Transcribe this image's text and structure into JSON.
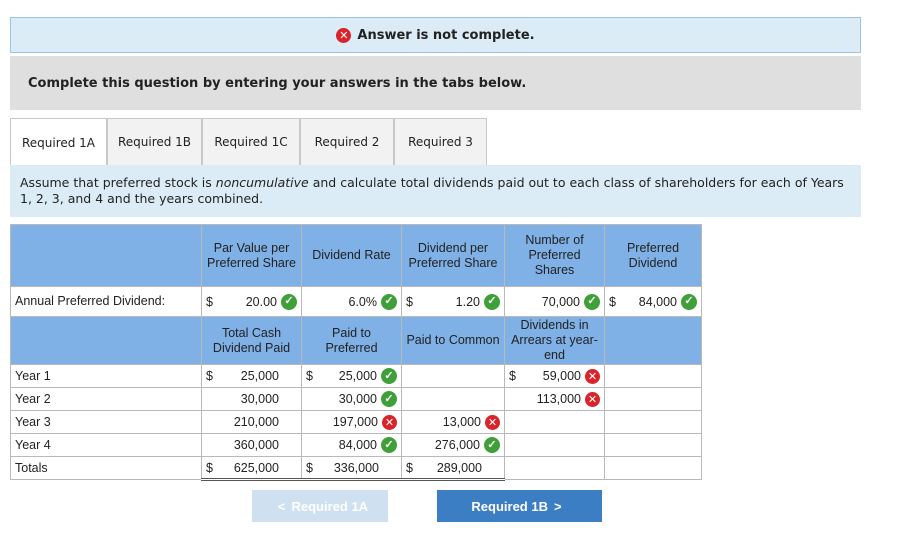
{
  "alert": {
    "text": "Answer is not complete."
  },
  "instruction": "Complete this question by entering your answers in the tabs below.",
  "tabs": [
    "Required 1A",
    "Required 1B",
    "Required 1C",
    "Required 2",
    "Required 3"
  ],
  "question": {
    "part1": "Assume that preferred stock is ",
    "emph": "noncumulative",
    "part2": " and calculate total dividends paid out to each class of shareholders for each of Years 1, 2, 3, and 4 and the years combined."
  },
  "table": {
    "header1": {
      "par_value": "Par Value per Preferred Share",
      "dividend_rate": "Dividend Rate",
      "dividend_per_share": "Dividend per Preferred Share",
      "num_shares": "Number of Preferred Shares",
      "preferred_dividend": "Preferred Dividend"
    },
    "annual": {
      "label": "Annual Preferred Dividend:",
      "par_value": "20.00",
      "dividend_rate": "6.0%",
      "dividend_per_share": "1.20",
      "num_shares": "70,000",
      "preferred_dividend": "84,000"
    },
    "header2": {
      "total_cash": "Total Cash Dividend Paid",
      "paid_pref": "Paid to Preferred",
      "paid_common": "Paid to Common",
      "arrears": "Dividends in Arrears at year-end"
    },
    "rows": [
      {
        "label": "Year 1",
        "total": "25,000",
        "pref": "25,000",
        "pref_status": "ok",
        "common": "",
        "common_status": "",
        "arrears": "59,000",
        "arrears_status": "x"
      },
      {
        "label": "Year 2",
        "total": "30,000",
        "pref": "30,000",
        "pref_status": "ok",
        "common": "",
        "common_status": "",
        "arrears": "113,000",
        "arrears_status": "x"
      },
      {
        "label": "Year 3",
        "total": "210,000",
        "pref": "197,000",
        "pref_status": "x",
        "common": "13,000",
        "common_status": "x",
        "arrears": "",
        "arrears_status": ""
      },
      {
        "label": "Year 4",
        "total": "360,000",
        "pref": "84,000",
        "pref_status": "ok",
        "common": "276,000",
        "common_status": "ok",
        "arrears": "",
        "arrears_status": ""
      },
      {
        "label": "Totals",
        "total": "625,000",
        "pref": "336,000",
        "pref_status": "",
        "common": "289,000",
        "common_status": "",
        "arrears": "",
        "arrears_status": ""
      }
    ],
    "currency": "$"
  },
  "nav": {
    "prev": "Required 1A",
    "next": "Required 1B"
  },
  "colors": {
    "header_blue": "#7fb0e6",
    "ok_green": "#3fa03a",
    "error_red": "#d9242b",
    "next_button": "#3c7ec4"
  }
}
